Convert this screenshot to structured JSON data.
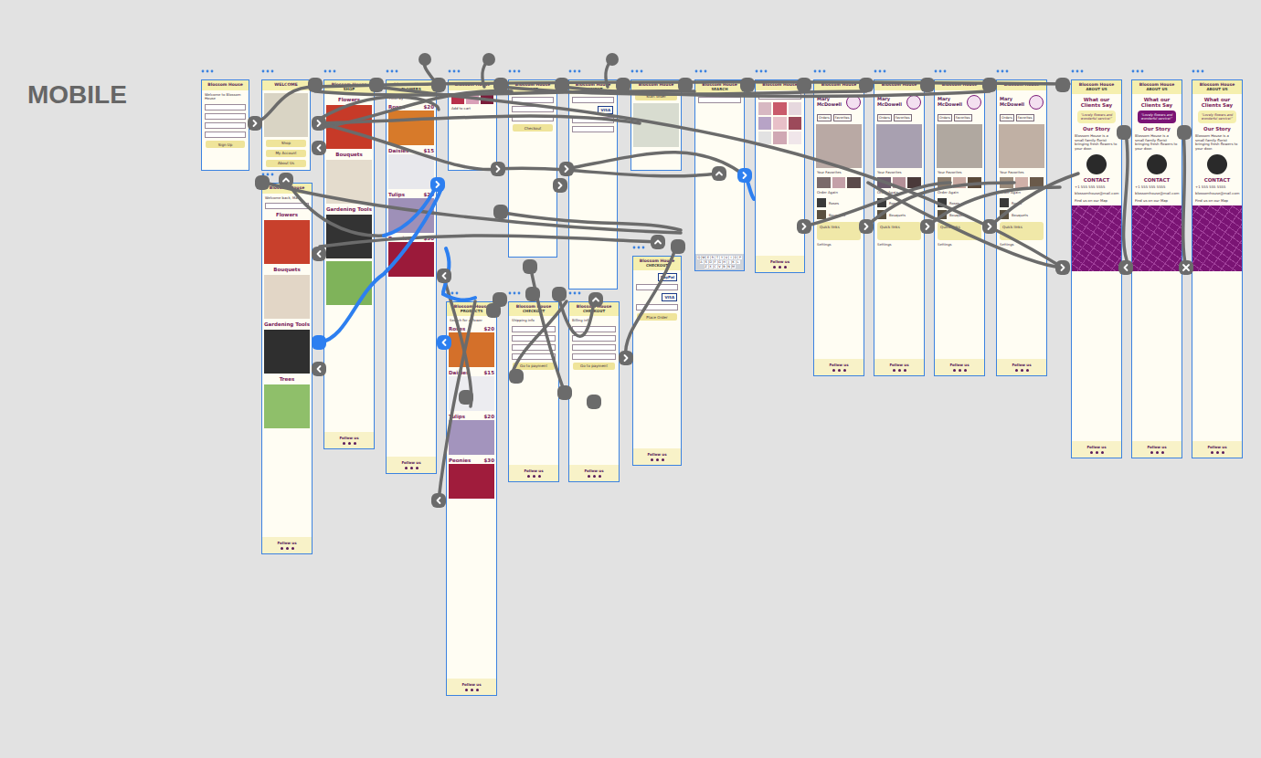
{
  "canvas": {
    "title": "MOBILE"
  },
  "boards": [
    {
      "name": "login",
      "sections": [
        {
          "kind": "header",
          "title": "Blossom House"
        },
        {
          "kind": "text",
          "text": "Welcome to Blossom House"
        },
        {
          "kind": "field"
        },
        {
          "kind": "field"
        },
        {
          "kind": "field"
        },
        {
          "kind": "field"
        },
        {
          "kind": "button",
          "label": "Sign Up"
        }
      ]
    },
    {
      "name": "welcome",
      "sections": [
        {
          "kind": "header",
          "title": "WELCOME"
        },
        {
          "kind": "photo",
          "color": "#d9d4c4"
        },
        {
          "kind": "button",
          "label": "Shop"
        },
        {
          "kind": "button",
          "label": "My Account"
        },
        {
          "kind": "button",
          "label": "About Us"
        }
      ]
    },
    {
      "name": "home",
      "sections": [
        {
          "kind": "header",
          "title": "Blossom House"
        },
        {
          "kind": "text",
          "text": "Welcome back, Mary"
        },
        {
          "kind": "field"
        },
        {
          "kind": "heading",
          "text": "Flowers"
        },
        {
          "kind": "photo",
          "color": "#c8402c"
        },
        {
          "kind": "heading",
          "text": "Bouquets"
        },
        {
          "kind": "photo",
          "color": "#e2d6c6"
        },
        {
          "kind": "heading",
          "text": "Gardening Tools"
        },
        {
          "kind": "photo",
          "color": "#2f2f2f"
        },
        {
          "kind": "heading",
          "text": "Trees"
        },
        {
          "kind": "photo",
          "color": "#8fbf6a"
        },
        {
          "kind": "footer",
          "title": "Follow us"
        }
      ]
    },
    {
      "name": "shop",
      "sections": [
        {
          "kind": "header",
          "title": "Blossom House",
          "subtitle": "SHOP"
        },
        {
          "kind": "heading",
          "text": "Flowers"
        },
        {
          "kind": "photo",
          "color": "#c73a28"
        },
        {
          "kind": "heading",
          "text": "Bouquets"
        },
        {
          "kind": "photo",
          "color": "#e4dccd"
        },
        {
          "kind": "heading",
          "text": "Gardening Tools"
        },
        {
          "kind": "photo",
          "color": "#333333"
        },
        {
          "kind": "photo",
          "color": "#7fb35a"
        },
        {
          "kind": "footer",
          "title": "Follow us"
        }
      ]
    },
    {
      "name": "product-list",
      "sections": [
        {
          "kind": "header",
          "title": "Blossom House",
          "subtitle": "FLOWERS"
        },
        {
          "kind": "text",
          "text": "Filter by"
        },
        {
          "kind": "product",
          "name": "Roses",
          "price": "$20",
          "color": "#d77a2a"
        },
        {
          "kind": "product",
          "name": "Daisies",
          "price": "$15",
          "color": "#e8e8ec"
        },
        {
          "kind": "product",
          "name": "Tulips",
          "price": "$20",
          "color": "#9e90b8"
        },
        {
          "kind": "product",
          "name": "Peonies",
          "price": "$30",
          "color": "#9b1a3a"
        },
        {
          "kind": "footer",
          "title": "Follow us"
        }
      ]
    },
    {
      "name": "product-detail",
      "sections": [
        {
          "kind": "header",
          "title": "Blossom House"
        },
        {
          "kind": "thumbs",
          "colors": [
            "#b8304a",
            "#d9a0b8",
            "#7a1c3a"
          ]
        },
        {
          "kind": "text",
          "text": "Add to cart"
        }
      ]
    },
    {
      "name": "products",
      "sections": [
        {
          "kind": "header",
          "title": "Blossom House",
          "subtitle": "PRODUCTS"
        },
        {
          "kind": "text",
          "text": "Search for a flower"
        },
        {
          "kind": "product",
          "name": "Roses",
          "price": "$20",
          "color": "#d4702a"
        },
        {
          "kind": "product",
          "name": "Daisies",
          "price": "$15",
          "color": "#ececf0"
        },
        {
          "kind": "product",
          "name": "Tulips",
          "price": "$20",
          "color": "#a394bd"
        },
        {
          "kind": "product",
          "name": "Peonies",
          "price": "$30",
          "color": "#a01c3c"
        },
        {
          "kind": "footer",
          "title": "Follow us"
        }
      ]
    },
    {
      "name": "cart",
      "sections": [
        {
          "kind": "header",
          "title": "Blossom House",
          "subtitle": "CART"
        },
        {
          "kind": "field"
        },
        {
          "kind": "field"
        },
        {
          "kind": "field"
        },
        {
          "kind": "button",
          "label": "Checkout"
        }
      ]
    },
    {
      "name": "checkout-shipping",
      "sections": [
        {
          "kind": "header",
          "title": "Blossom House",
          "subtitle": "CHECKOUT"
        },
        {
          "kind": "text",
          "text": "Shipping info"
        },
        {
          "kind": "field"
        },
        {
          "kind": "field"
        },
        {
          "kind": "field"
        },
        {
          "kind": "field"
        },
        {
          "kind": "button",
          "label": "Go to payment"
        },
        {
          "kind": "footer",
          "title": "Follow us"
        }
      ]
    },
    {
      "name": "payment",
      "sections": [
        {
          "kind": "header",
          "title": "Blossom House",
          "subtitle": "PAYMENT"
        },
        {
          "kind": "field"
        },
        {
          "kind": "badge",
          "label": "VISA"
        },
        {
          "kind": "field"
        },
        {
          "kind": "field"
        }
      ]
    },
    {
      "name": "checkout-billing",
      "sections": [
        {
          "kind": "header",
          "title": "Blossom House",
          "subtitle": "CHECKOUT"
        },
        {
          "kind": "text",
          "text": "Billing info"
        },
        {
          "kind": "field"
        },
        {
          "kind": "field"
        },
        {
          "kind": "field"
        },
        {
          "kind": "field"
        },
        {
          "kind": "button",
          "label": "Go to payment"
        },
        {
          "kind": "footer",
          "title": "Follow us"
        }
      ]
    },
    {
      "name": "order-photo",
      "sections": [
        {
          "kind": "header",
          "title": "Blossom House"
        },
        {
          "kind": "button",
          "label": "Start order"
        },
        {
          "kind": "photo",
          "color": "#d8dcd0"
        }
      ]
    },
    {
      "name": "payment-methods",
      "sections": [
        {
          "kind": "header",
          "title": "Blossom House",
          "subtitle": "CHECKOUT"
        },
        {
          "kind": "badge",
          "label": "PayPal"
        },
        {
          "kind": "field"
        },
        {
          "kind": "badge",
          "label": "VISA"
        },
        {
          "kind": "field"
        },
        {
          "kind": "button",
          "label": "Place Order"
        },
        {
          "kind": "footer",
          "title": "Follow us"
        }
      ]
    },
    {
      "name": "search",
      "sections": [
        {
          "kind": "header",
          "title": "Blossom House",
          "subtitle": "SEARCH"
        },
        {
          "kind": "field"
        },
        {
          "kind": "spacer"
        },
        {
          "kind": "keyboard",
          "rows": [
            [
              "Q",
              "W",
              "E",
              "R",
              "T",
              "Y",
              "U",
              "I",
              "O",
              "P"
            ],
            [
              "A",
              "S",
              "D",
              "F",
              "G",
              "H",
              "J",
              "K",
              "L"
            ],
            [
              "Z",
              "X",
              "C",
              "V",
              "B",
              "N",
              "M"
            ]
          ]
        }
      ]
    },
    {
      "name": "gallery",
      "sections": [
        {
          "kind": "header",
          "title": "Blossom House"
        },
        {
          "kind": "field"
        },
        {
          "kind": "grid",
          "colors": [
            "#d7b8c2",
            "#c95a6a",
            "#e6d8de",
            "#b7a3c6",
            "#e8c0c8",
            "#9c4a5a",
            "#e2e2e2",
            "#d0a8b4",
            "#f0e6ea"
          ]
        },
        {
          "kind": "footer",
          "title": "Follow us"
        }
      ]
    },
    {
      "name": "profile",
      "sections": [
        {
          "kind": "header",
          "title": "Blossom House"
        },
        {
          "kind": "avatar",
          "name": "Mary McDowell"
        },
        {
          "kind": "chips",
          "labels": [
            "Orders",
            "Favorites"
          ]
        },
        {
          "kind": "photo",
          "color": "#b9a9a4"
        },
        {
          "kind": "text",
          "text": "Your Favorites"
        },
        {
          "kind": "thumbs",
          "colors": [
            "#7a6a6a",
            "#c4a0a8",
            "#5a4a4a"
          ]
        },
        {
          "kind": "text",
          "text": "Order Again"
        },
        {
          "kind": "item",
          "name": "Roses",
          "color": "#3a3a3a"
        },
        {
          "kind": "item",
          "name": "Bouquets",
          "color": "#5a5040"
        },
        {
          "kind": "panel",
          "title": "Quick links"
        },
        {
          "kind": "text",
          "text": "Settings"
        },
        {
          "kind": "footer",
          "title": "Follow us"
        }
      ]
    },
    {
      "name": "profile-orders",
      "sections": [
        {
          "kind": "header",
          "title": "Blossom House"
        },
        {
          "kind": "avatar",
          "name": "Mary McDowell"
        },
        {
          "kind": "chips",
          "labels": [
            "Orders",
            "Favorites"
          ]
        },
        {
          "kind": "photo",
          "color": "#a8a0b0"
        },
        {
          "kind": "text",
          "text": "Your Favorites"
        },
        {
          "kind": "thumbs",
          "colors": [
            "#6a5a6a",
            "#b49098",
            "#4a3a3a"
          ]
        },
        {
          "kind": "text",
          "text": "Order Again"
        },
        {
          "kind": "item",
          "name": "Roses",
          "color": "#3a3a3a"
        },
        {
          "kind": "item",
          "name": "Bouquets",
          "color": "#5a5040"
        },
        {
          "kind": "panel",
          "title": "Quick links"
        },
        {
          "kind": "text",
          "text": "Settings"
        },
        {
          "kind": "footer",
          "title": "Follow us"
        }
      ]
    },
    {
      "name": "profile-favorites",
      "sections": [
        {
          "kind": "header",
          "title": "Blossom House"
        },
        {
          "kind": "avatar",
          "name": "Mary McDowell"
        },
        {
          "kind": "chips",
          "labels": [
            "Orders",
            "Favorites"
          ]
        },
        {
          "kind": "photo",
          "color": "#b0a8a0"
        },
        {
          "kind": "text",
          "text": "Your Favorites"
        },
        {
          "kind": "thumbs",
          "colors": [
            "#8a7a6a",
            "#c8a8a0",
            "#5a4a3a"
          ]
        },
        {
          "kind": "text",
          "text": "Order Again"
        },
        {
          "kind": "item",
          "name": "Roses",
          "color": "#3a3a3a"
        },
        {
          "kind": "item",
          "name": "Bouquets",
          "color": "#5a5040"
        },
        {
          "kind": "panel",
          "title": "Quick links"
        },
        {
          "kind": "text",
          "text": "Settings"
        },
        {
          "kind": "footer",
          "title": "Follow us"
        }
      ]
    },
    {
      "name": "profile-settings",
      "sections": [
        {
          "kind": "header",
          "title": "Blossom House"
        },
        {
          "kind": "avatar",
          "name": "Mary McDowell"
        },
        {
          "kind": "chips",
          "labels": [
            "Orders",
            "Favorites"
          ]
        },
        {
          "kind": "photo",
          "color": "#c0b0a4"
        },
        {
          "kind": "text",
          "text": "Your Favorites"
        },
        {
          "kind": "thumbs",
          "colors": [
            "#9a8a7a",
            "#d0b0a8",
            "#6a5a4a"
          ]
        },
        {
          "kind": "text",
          "text": "Order Again"
        },
        {
          "kind": "item",
          "name": "Roses",
          "color": "#3a3a3a"
        },
        {
          "kind": "item",
          "name": "Bouquets",
          "color": "#5a5040"
        },
        {
          "kind": "panel",
          "title": "Quick links"
        },
        {
          "kind": "text",
          "text": "Settings"
        },
        {
          "kind": "footer",
          "title": "Follow us"
        }
      ]
    },
    {
      "name": "about",
      "sections": [
        {
          "kind": "header",
          "title": "Blossom House",
          "subtitle": "ABOUT US"
        },
        {
          "kind": "heading",
          "text": "What our Clients Say"
        },
        {
          "kind": "quote",
          "text": "“Lovely flowers and wonderful service!”",
          "highlighted": false
        },
        {
          "kind": "heading",
          "text": "Our Story"
        },
        {
          "kind": "text",
          "text": "Blossom House is a small family florist bringing fresh flowers to your door."
        },
        {
          "kind": "portrait",
          "color": "#2a2a2a"
        },
        {
          "kind": "heading",
          "text": "CONTACT"
        },
        {
          "kind": "text",
          "text": "+1 555 555 5555"
        },
        {
          "kind": "text",
          "text": "blossomhouse@mail.com"
        },
        {
          "kind": "text",
          "text": "Find us on our Map"
        },
        {
          "kind": "map"
        },
        {
          "kind": "footer",
          "title": "Follow us"
        }
      ]
    },
    {
      "name": "about-quote",
      "sections": [
        {
          "kind": "header",
          "title": "Blossom House",
          "subtitle": "ABOUT US"
        },
        {
          "kind": "heading",
          "text": "What our Clients Say"
        },
        {
          "kind": "quote",
          "text": "“Lovely flowers and wonderful service!”",
          "highlighted": true
        },
        {
          "kind": "heading",
          "text": "Our Story"
        },
        {
          "kind": "text",
          "text": "Blossom House is a small family florist bringing fresh flowers to your door."
        },
        {
          "kind": "portrait",
          "color": "#2a2a2a"
        },
        {
          "kind": "heading",
          "text": "CONTACT"
        },
        {
          "kind": "text",
          "text": "+1 555 555 5555"
        },
        {
          "kind": "text",
          "text": "blossomhouse@mail.com"
        },
        {
          "kind": "text",
          "text": "Find us on our Map"
        },
        {
          "kind": "map"
        },
        {
          "kind": "footer",
          "title": "Follow us"
        }
      ]
    },
    {
      "name": "about-contact",
      "sections": [
        {
          "kind": "header",
          "title": "Blossom House",
          "subtitle": "ABOUT US"
        },
        {
          "kind": "heading",
          "text": "What our Clients Say"
        },
        {
          "kind": "quote",
          "text": "“Lovely flowers and wonderful service!”",
          "highlighted": false
        },
        {
          "kind": "heading",
          "text": "Our Story"
        },
        {
          "kind": "text",
          "text": "Blossom House is a small family florist bringing fresh flowers to your door."
        },
        {
          "kind": "portrait",
          "color": "#2a2a2a"
        },
        {
          "kind": "heading",
          "text": "CONTACT"
        },
        {
          "kind": "text",
          "text": "+1 555 555 5555"
        },
        {
          "kind": "text",
          "text": "blossomhouse@mail.com"
        },
        {
          "kind": "text",
          "text": "Find us on our Map"
        },
        {
          "kind": "map"
        },
        {
          "kind": "footer",
          "title": "Follow us"
        }
      ]
    }
  ]
}
